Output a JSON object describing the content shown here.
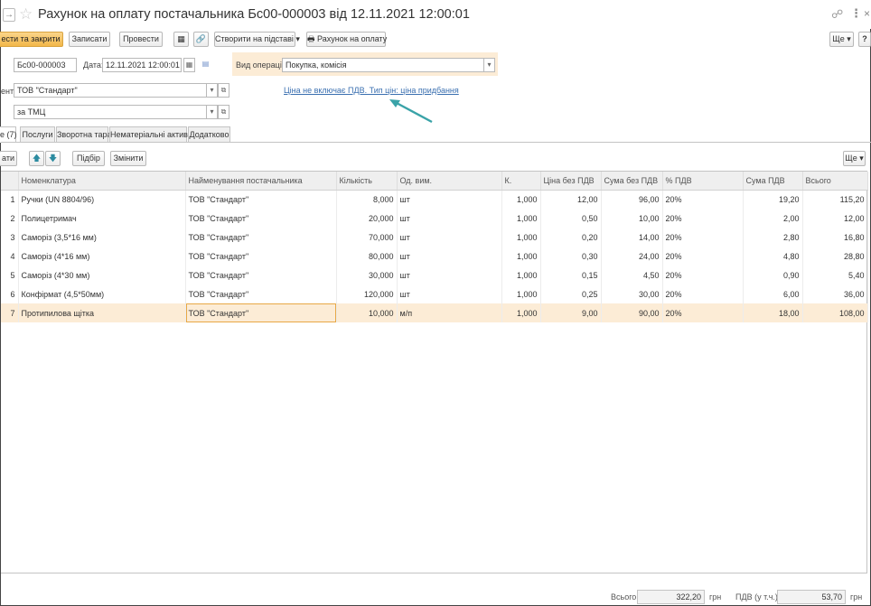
{
  "window": {
    "title": "Рахунок на оплату постачальника Бс00-000003 від 12.11.2021 12:00:01",
    "nav_arrow": "→",
    "star_icon": "☆",
    "link_icon": "☍",
    "more_icon": "⋮",
    "close_icon": "×"
  },
  "toolbar": {
    "post_close": "ести та закрити",
    "save": "Записати",
    "post": "Провести",
    "structure_icon": "▦",
    "attach_icon": "🔗",
    "create_based": "Створити на підставі",
    "print_icon": "🖶",
    "print_invoice": "Рахунок на оплату",
    "more": "Ще",
    "help": "?",
    "dropdown_glyph": "▾"
  },
  "header": {
    "number_value": "Бс00-000003",
    "date_label": "Дата:",
    "date_value": "12.11.2021 12:00:01",
    "operation_label": "Вид операції:",
    "operation_value": "Покупка, комісія",
    "counterparty_label": "ент:",
    "counterparty_value": "ТОВ \"Стандарт\"",
    "contract_value": "за ТМЦ",
    "price_link": "Ціна не включає ПДВ. Тип цін: ціна придбання"
  },
  "tabs": [
    {
      "label": "е (7)"
    },
    {
      "label": "Послуги"
    },
    {
      "label": "Зворотна тара"
    },
    {
      "label": "Нематеріальні активи"
    },
    {
      "label": "Додатково"
    }
  ],
  "table_toolbar": {
    "add": "ати",
    "up_icon": "🡅",
    "down_icon": "🡇",
    "selection": "Підбір",
    "change": "Змінити",
    "more": "Ще"
  },
  "table": {
    "columns": [
      "Номенклатура",
      "Найменування постачальника",
      "Кількість",
      "Од. вим.",
      "К.",
      "Ціна без ПДВ",
      "Сума без ПДВ",
      "% ПДВ",
      "Сума ПДВ",
      "Всього"
    ],
    "rows": [
      {
        "n": "1",
        "item": "Ручки (UN 8804/96)",
        "supplier": "ТОВ \"Стандарт\"",
        "qty": "8,000",
        "unit": "шт",
        "k": "1,000",
        "price": "12,00",
        "sum": "96,00",
        "vat_rate": "20%",
        "vat": "19,20",
        "total": "115,20"
      },
      {
        "n": "2",
        "item": "Полицетримач",
        "supplier": "ТОВ \"Стандарт\"",
        "qty": "20,000",
        "unit": "шт",
        "k": "1,000",
        "price": "0,50",
        "sum": "10,00",
        "vat_rate": "20%",
        "vat": "2,00",
        "total": "12,00"
      },
      {
        "n": "3",
        "item": "Саморіз (3,5*16 мм)",
        "supplier": "ТОВ \"Стандарт\"",
        "qty": "70,000",
        "unit": "шт",
        "k": "1,000",
        "price": "0,20",
        "sum": "14,00",
        "vat_rate": "20%",
        "vat": "2,80",
        "total": "16,80"
      },
      {
        "n": "4",
        "item": "Саморіз (4*16 мм)",
        "supplier": "ТОВ \"Стандарт\"",
        "qty": "80,000",
        "unit": "шт",
        "k": "1,000",
        "price": "0,30",
        "sum": "24,00",
        "vat_rate": "20%",
        "vat": "4,80",
        "total": "28,80"
      },
      {
        "n": "5",
        "item": "Саморіз (4*30 мм)",
        "supplier": "ТОВ \"Стандарт\"",
        "qty": "30,000",
        "unit": "шт",
        "k": "1,000",
        "price": "0,15",
        "sum": "4,50",
        "vat_rate": "20%",
        "vat": "0,90",
        "total": "5,40"
      },
      {
        "n": "6",
        "item": "Конфірмат (4,5*50мм)",
        "supplier": "ТОВ \"Стандарт\"",
        "qty": "120,000",
        "unit": "шт",
        "k": "1,000",
        "price": "0,25",
        "sum": "30,00",
        "vat_rate": "20%",
        "vat": "6,00",
        "total": "36,00"
      },
      {
        "n": "7",
        "item": "Протипилова щітка",
        "supplier": "ТОВ \"Стандарт\"",
        "qty": "10,000",
        "unit": "м/п",
        "k": "1,000",
        "price": "9,00",
        "sum": "90,00",
        "vat_rate": "20%",
        "vat": "18,00",
        "total": "108,00"
      }
    ],
    "selected_row": 7
  },
  "footer": {
    "total_label": "Всього:",
    "total_value": "322,20",
    "currency": "грн",
    "vat_label": "ПДВ (у т.ч.):",
    "vat_value": "53,70",
    "currency2": "грн"
  },
  "colors": {
    "primary_button": "#f2b74a",
    "selected_row": "#fcecd6",
    "link": "#3a6fb0",
    "annotation_arrow": "#3aa3a8"
  }
}
